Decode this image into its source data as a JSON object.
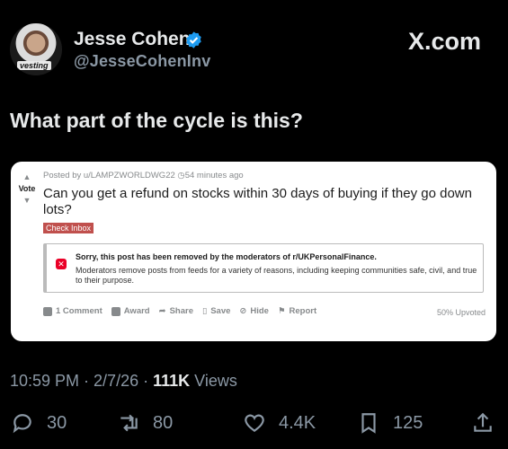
{
  "author": {
    "name": "Jesse Cohen",
    "handle": "@JesseCohenInv",
    "avatar_badge": "vesting"
  },
  "brand": "X.com",
  "tweet_text": "What part of the cycle is this?",
  "embed": {
    "vote_label": "Vote",
    "posted_by": "Posted by u/LAMPZWORLDWG22",
    "time_ago": "54 minutes ago",
    "title": "Can you get a refund on stocks within 30 days of buying if they go down lots?",
    "flair": "Check Inbox",
    "notice_title": "Sorry, this post has been removed by the moderators of r/UKPersonalFinance.",
    "notice_body": "Moderators remove posts from feeds for a variety of reasons, including keeping communities safe, civil, and true to their purpose.",
    "actions": [
      "1 Comment",
      "Award",
      "Share",
      "Save",
      "Hide",
      "Report"
    ],
    "upvoted": "50% Upvoted"
  },
  "timestamp": {
    "time": "10:59 PM",
    "date": "2/7/26",
    "views_count": "111K",
    "views_label": "Views"
  },
  "metrics": {
    "replies": "30",
    "reposts": "80",
    "likes": "4.4K",
    "bookmarks": "125"
  },
  "colors": {
    "verified": "#1d9bf0",
    "flair": "#c0504d",
    "removed": "#ea0027"
  }
}
